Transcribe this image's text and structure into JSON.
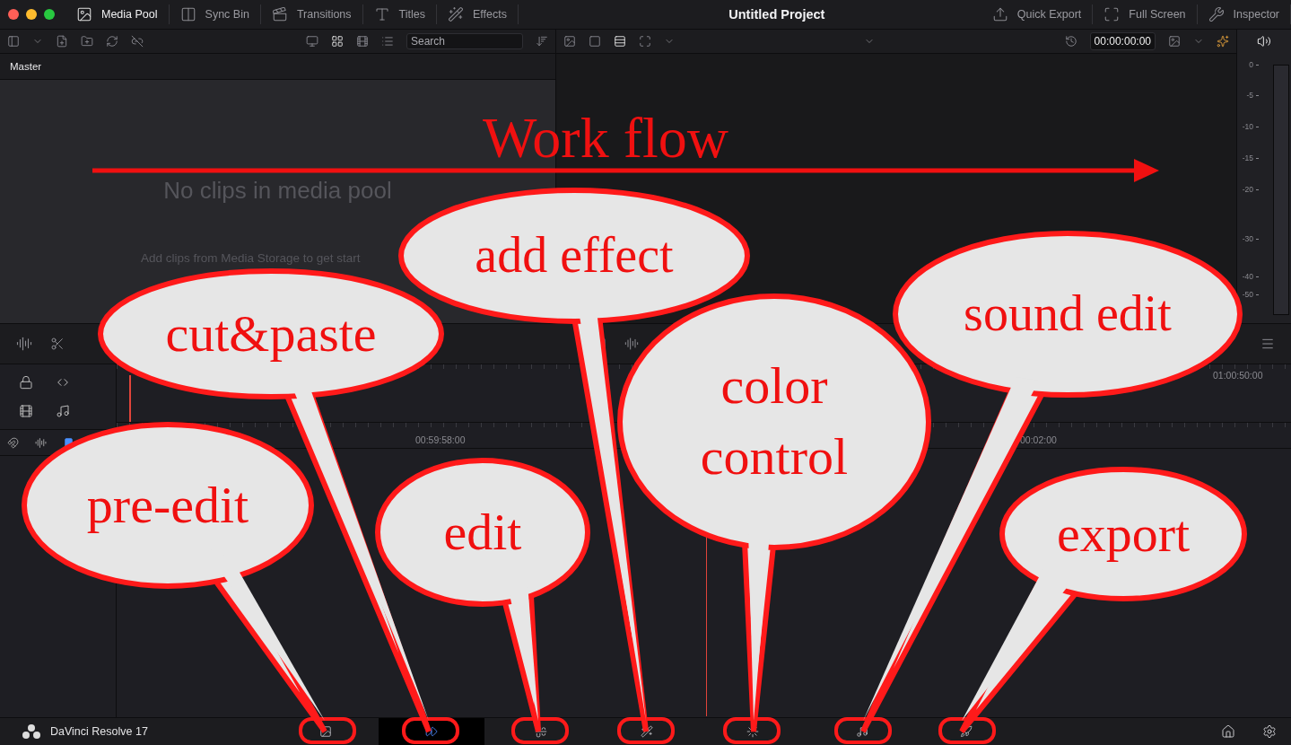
{
  "window": {
    "title": "Untitled Project"
  },
  "toolbar_left": [
    {
      "label": "Media Pool",
      "kind": "media",
      "selected": true
    },
    {
      "label": "Sync Bin",
      "kind": "sync",
      "selected": false
    },
    {
      "label": "Transitions",
      "kind": "transitions",
      "selected": false
    },
    {
      "label": "Titles",
      "kind": "titles",
      "selected": false
    },
    {
      "label": "Effects",
      "kind": "effects",
      "selected": false
    }
  ],
  "toolbar_right": [
    {
      "label": "Quick Export",
      "kind": "export"
    },
    {
      "label": "Full Screen",
      "kind": "fullscreen"
    },
    {
      "label": "Inspector",
      "kind": "inspector"
    }
  ],
  "media_pool": {
    "search": {
      "placeholder": "Search"
    },
    "bin": "Master",
    "empty_title": "No clips in media pool",
    "empty_hint": "Add clips from Media Storage to get start"
  },
  "viewer": {
    "timecode": "00:00:00:00"
  },
  "audio_meter": {
    "scale": [
      "0",
      "-5",
      "-10",
      "-15",
      "-20",
      "-30",
      "-40",
      "-50"
    ]
  },
  "timeline": {
    "upper_ruler": [
      "01:00:50:00"
    ],
    "lower_ruler": [
      "00:59:58:00",
      "00:02:00"
    ]
  },
  "page_bar": {
    "app_name": "DaVinci Resolve 17",
    "pages": [
      {
        "kind": "media",
        "selected": false
      },
      {
        "kind": "cut",
        "selected": true
      },
      {
        "kind": "edit",
        "selected": false
      },
      {
        "kind": "fusion",
        "selected": false
      },
      {
        "kind": "color",
        "selected": false
      },
      {
        "kind": "fairlight",
        "selected": false
      },
      {
        "kind": "deliver",
        "selected": false
      }
    ]
  },
  "annotations": {
    "title": "Work flow",
    "bubbles": [
      {
        "lines": [
          "cut&paste"
        ]
      },
      {
        "lines": [
          "add effect"
        ]
      },
      {
        "lines": [
          "color",
          "control"
        ]
      },
      {
        "lines": [
          "sound edit"
        ]
      },
      {
        "lines": [
          "pre-edit"
        ]
      },
      {
        "lines": [
          "edit"
        ]
      },
      {
        "lines": [
          "export"
        ]
      }
    ]
  }
}
